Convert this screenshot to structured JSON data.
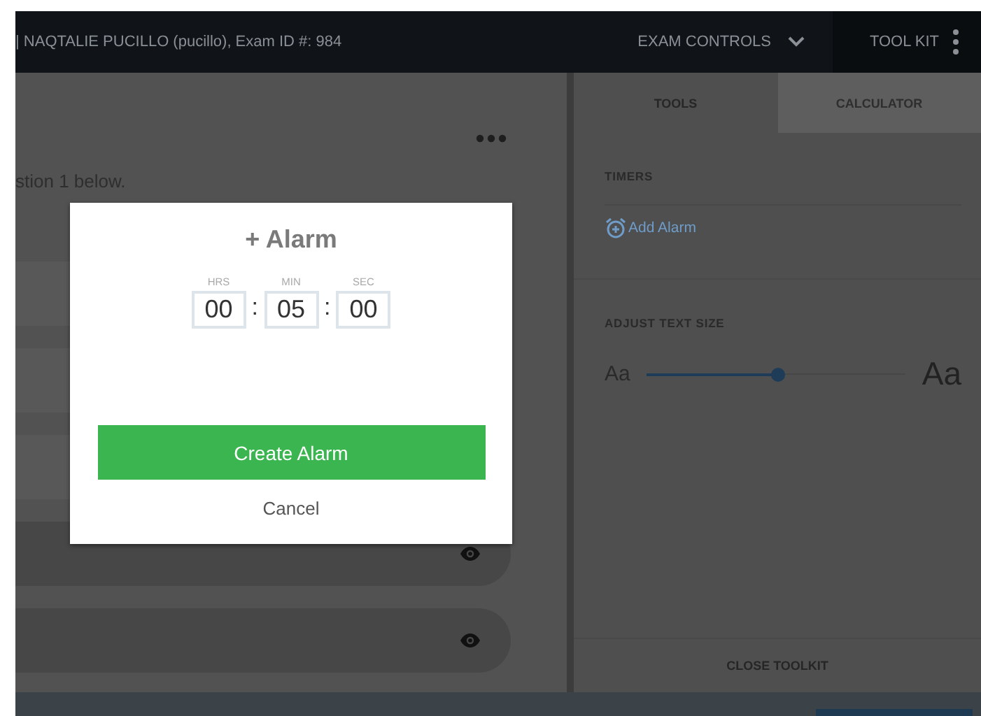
{
  "header": {
    "title": "| NAQTALIE PUCILLO (pucillo), Exam ID #: 984",
    "exam_controls": "EXAM CONTROLS",
    "tool_kit": "TOOL KIT"
  },
  "question": {
    "prompt": "stion 1 below."
  },
  "toolkit": {
    "tabs": [
      {
        "label": "TOOLS",
        "selected": true
      },
      {
        "label": "CALCULATOR",
        "selected": false
      }
    ],
    "timers_heading": "TIMERS",
    "add_alarm": "Add Alarm",
    "text_size_heading": "ADJUST TEXT SIZE",
    "slider": {
      "small_label": "Aa",
      "large_label": "Aa",
      "level": 0.51
    },
    "close": "CLOSE TOOLKIT"
  },
  "modal": {
    "title": "+ Alarm",
    "fields": [
      {
        "label": "HRS",
        "value": "00"
      },
      {
        "label": "MIN",
        "value": "05"
      },
      {
        "label": "SEC",
        "value": "00"
      }
    ],
    "separators": [
      ":",
      ":"
    ],
    "create_button": "Create Alarm",
    "cancel_button": "Cancel"
  }
}
